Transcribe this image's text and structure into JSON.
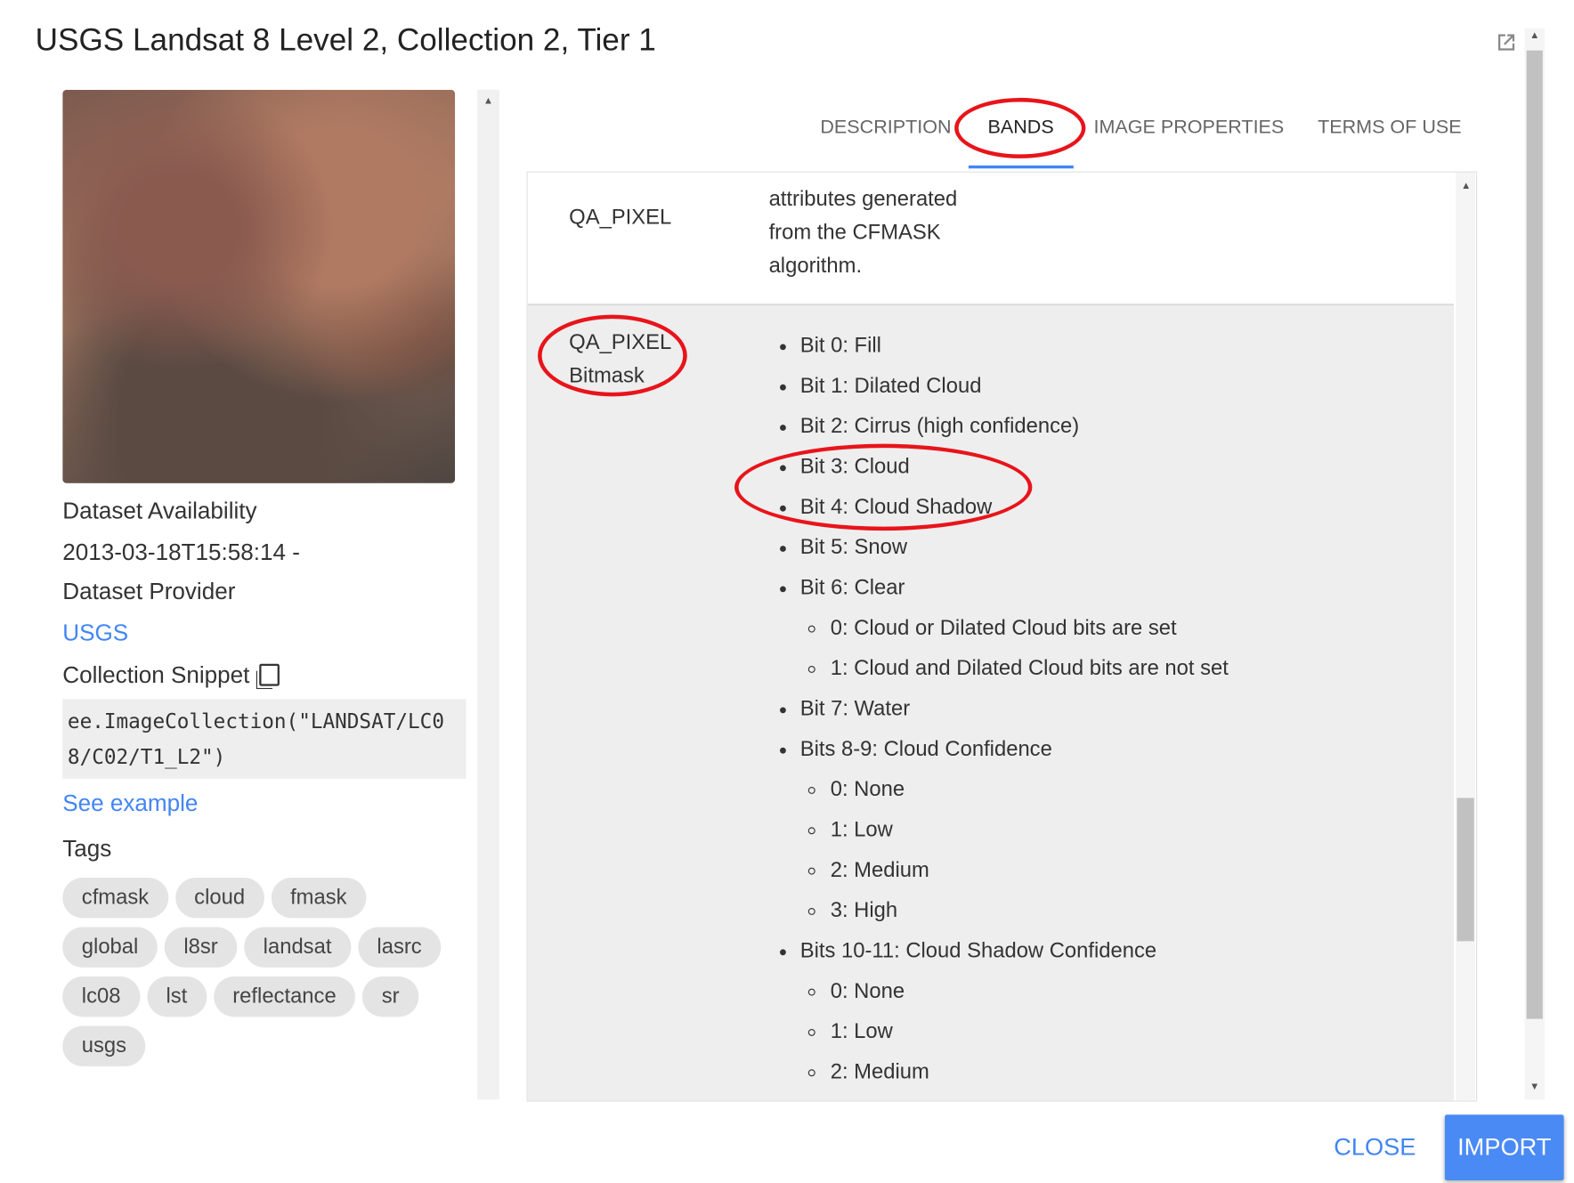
{
  "dialog": {
    "title": "USGS Landsat 8 Level 2, Collection 2, Tier 1",
    "popout_icon": "open-in-new-icon"
  },
  "sidebar": {
    "availability_label": "Dataset Availability",
    "availability_value": "2013-03-18T15:58:14 -",
    "provider_label": "Dataset Provider",
    "provider_link": "USGS",
    "snippet_label": "Collection Snippet",
    "snippet_code": "ee.ImageCollection(\"LANDSAT/LC08/C02/T1_L2\")",
    "see_example": "See example",
    "tags_label": "Tags",
    "tags": [
      "cfmask",
      "cloud",
      "fmask",
      "global",
      "l8sr",
      "landsat",
      "lasrc",
      "lc08",
      "lst",
      "reflectance",
      "sr",
      "usgs"
    ]
  },
  "tabs": [
    {
      "label": "DESCRIPTION",
      "active": false
    },
    {
      "label": "BANDS",
      "active": true
    },
    {
      "label": "IMAGE PROPERTIES",
      "active": false
    },
    {
      "label": "TERMS OF USE",
      "active": false
    }
  ],
  "bands": {
    "row1": {
      "name": "QA_PIXEL",
      "description_lines": [
        "attributes generated",
        "from the CFMASK",
        "algorithm."
      ]
    },
    "row2": {
      "name_line1": "QA_PIXEL",
      "name_line2": "Bitmask",
      "items": [
        {
          "text": "Bit 0: Fill",
          "level": 1
        },
        {
          "text": "Bit 1: Dilated Cloud",
          "level": 1
        },
        {
          "text": "Bit 2: Cirrus (high confidence)",
          "level": 1
        },
        {
          "text": "Bit 3: Cloud",
          "level": 1
        },
        {
          "text": "Bit 4: Cloud Shadow",
          "level": 1
        },
        {
          "text": "Bit 5: Snow",
          "level": 1
        },
        {
          "text": "Bit 6: Clear",
          "level": 1
        },
        {
          "text": "0: Cloud or Dilated Cloud bits are set",
          "level": 2
        },
        {
          "text": "1: Cloud and Dilated Cloud bits are not set",
          "level": 2
        },
        {
          "text": "Bit 7: Water",
          "level": 1
        },
        {
          "text": "Bits 8-9: Cloud Confidence",
          "level": 1
        },
        {
          "text": "0: None",
          "level": 2
        },
        {
          "text": "1: Low",
          "level": 2
        },
        {
          "text": "2: Medium",
          "level": 2
        },
        {
          "text": "3: High",
          "level": 2
        },
        {
          "text": "Bits 10-11: Cloud Shadow Confidence",
          "level": 1
        },
        {
          "text": "0: None",
          "level": 2
        },
        {
          "text": "1: Low",
          "level": 2
        },
        {
          "text": "2: Medium",
          "level": 2
        }
      ]
    }
  },
  "footer": {
    "close": "CLOSE",
    "import": "IMPORT"
  },
  "colors": {
    "accent": "#4285f4",
    "annotation": "#e8141b"
  }
}
